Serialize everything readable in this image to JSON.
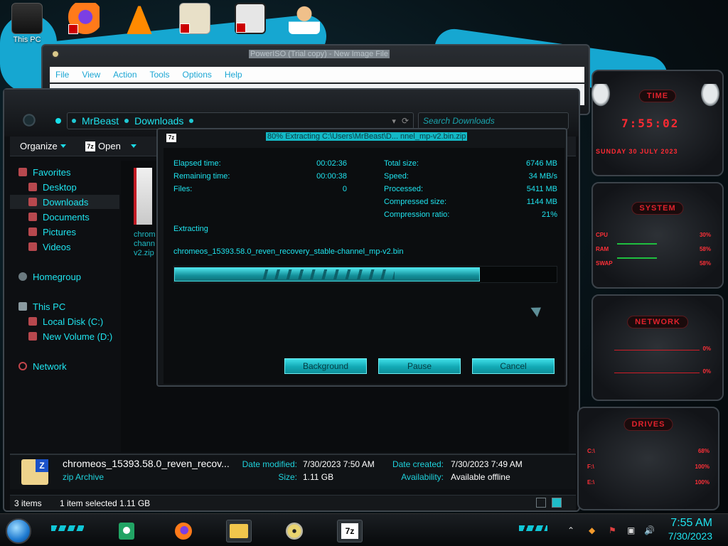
{
  "desktop": {
    "icons": [
      {
        "name": "this-pc-desktop-icon",
        "label": "This PC"
      },
      {
        "name": "firefox-desktop-icon",
        "label": ""
      },
      {
        "name": "vlc-desktop-icon",
        "label": ""
      },
      {
        "name": "hxd-desktop-icon",
        "label": ""
      },
      {
        "name": "app-desktop-icon",
        "label": ""
      },
      {
        "name": "doctor-desktop-icon",
        "label": ""
      }
    ]
  },
  "poweriso": {
    "title": "PowerISO (Trial copy) - New Image File",
    "menu": [
      "File",
      "View",
      "Action",
      "Tools",
      "Options",
      "Help"
    ]
  },
  "explorer": {
    "breadcrumb": [
      "MrBeast",
      "Downloads"
    ],
    "search_placeholder": "Search Downloads",
    "organize_label": "Organize",
    "open_label": "Open",
    "nav": {
      "favorites": "Favorites",
      "desktop": "Desktop",
      "downloads": "Downloads",
      "documents": "Documents",
      "pictures": "Pictures",
      "videos": "Videos",
      "homegroup": "Homegroup",
      "this_pc": "This PC",
      "local_disk": "Local Disk (C:)",
      "new_volume": "New Volume (D:)",
      "network": "Network"
    },
    "content_peek_text": "chromeos_15393.58.0_reven_recovery_stable-channel_mp-v2.zip",
    "details": {
      "file_name": "chromeos_15393.58.0_reven_recov...",
      "file_type": "zip Archive",
      "date_modified_label": "Date modified:",
      "date_modified": "7/30/2023 7:50 AM",
      "size_label": "Size:",
      "size": "1.11 GB",
      "date_created_label": "Date created:",
      "date_created": "7/30/2023 7:49 AM",
      "availability_label": "Availability:",
      "availability": "Available offline"
    },
    "status": {
      "items": "3 items",
      "selected": "1 item selected  1.11 GB"
    }
  },
  "dialog": {
    "title": "80% Extracting C:\\Users\\MrBeast\\D... nnel_mp-v2.bin.zip",
    "elapsed_label": "Elapsed time:",
    "elapsed": "00:02:36",
    "remaining_label": "Remaining time:",
    "remaining": "00:00:38",
    "files_label": "Files:",
    "files": "0",
    "total_label": "Total size:",
    "total": "6746 MB",
    "speed_label": "Speed:",
    "speed": "34 MB/s",
    "processed_label": "Processed:",
    "processed": "5411 MB",
    "compressed_label": "Compressed size:",
    "compressed": "1144 MB",
    "ratio_label": "Compression ratio:",
    "ratio": "21%",
    "status": "Extracting",
    "file": "chromeos_15393.58.0_reven_recovery_stable-channel_mp-v2.bin",
    "progress": 0.8,
    "buttons": {
      "background": "Background",
      "pause": "Pause",
      "cancel": "Cancel"
    }
  },
  "gadgets": {
    "time_title": "TIME",
    "time_value": "7:55:02",
    "date_value": "SUNDAY 30 JULY 2023",
    "system_title": "SYSTEM",
    "cpu_label": "CPU",
    "cpu_value": "30%",
    "ram_label": "RAM",
    "ram_value": "58%",
    "swap_label": "SWAP",
    "swap_value": "58%",
    "network_title": "NETWORK",
    "net_in": "0%",
    "net_out": "0%",
    "drives_title": "DRIVES",
    "drive_c_label": "C:\\",
    "drive_c_value": "68%",
    "drive_f_label": "F:\\",
    "drive_f_value": "100%",
    "drive_e_label": "E:\\",
    "drive_e_value": "100%"
  },
  "taskbar": {
    "time": "7:55 AM",
    "date": "7/30/2023",
    "apps": [
      "google-sheets-icon",
      "firefox-icon",
      "file-explorer-icon",
      "poweriso-disc-icon",
      "7zip-icon"
    ]
  },
  "colors": {
    "accent": "#1fe3ee",
    "gadget_red": "#ff2a33"
  }
}
